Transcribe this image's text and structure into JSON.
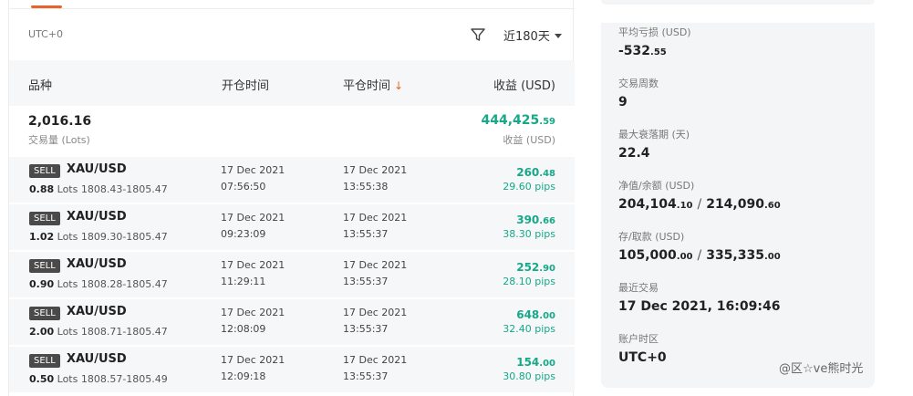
{
  "filter": {
    "timezone": "UTC+0",
    "period": "近180天"
  },
  "table": {
    "headers": {
      "symbol": "品种",
      "open_time": "开仓时间",
      "close_time": "平仓时间",
      "profit": "收益 (USD)"
    }
  },
  "summary": {
    "volume": "2,016.16",
    "volume_label": "交易量 (Lots)",
    "profit_int": "444,425",
    "profit_dec": ".59",
    "profit_label": "收益 (USD)"
  },
  "trades": [
    {
      "side": "SELL",
      "symbol": "XAU/USD",
      "lots": "0.88",
      "lots_suffix": " Lots  1808.43-1805.47",
      "open_date": "17 Dec 2021",
      "open_time": "07:56:50",
      "close_date": "17 Dec 2021",
      "close_time": "13:55:38",
      "profit_int": "260",
      "profit_dec": ".48",
      "pips": "29.60 pips"
    },
    {
      "side": "SELL",
      "symbol": "XAU/USD",
      "lots": "1.02",
      "lots_suffix": " Lots  1809.30-1805.47",
      "open_date": "17 Dec 2021",
      "open_time": "09:23:09",
      "close_date": "17 Dec 2021",
      "close_time": "13:55:37",
      "profit_int": "390",
      "profit_dec": ".66",
      "pips": "38.30 pips"
    },
    {
      "side": "SELL",
      "symbol": "XAU/USD",
      "lots": "0.90",
      "lots_suffix": " Lots  1808.28-1805.47",
      "open_date": "17 Dec 2021",
      "open_time": "11:29:11",
      "close_date": "17 Dec 2021",
      "close_time": "13:55:37",
      "profit_int": "252",
      "profit_dec": ".90",
      "pips": "28.10 pips"
    },
    {
      "side": "SELL",
      "symbol": "XAU/USD",
      "lots": "2.00",
      "lots_suffix": " Lots  1808.71-1805.47",
      "open_date": "17 Dec 2021",
      "open_time": "12:08:09",
      "close_date": "17 Dec 2021",
      "close_time": "13:55:37",
      "profit_int": "648",
      "profit_dec": ".00",
      "pips": "32.40 pips"
    },
    {
      "side": "SELL",
      "symbol": "XAU/USD",
      "lots": "0.50",
      "lots_suffix": " Lots  1808.57-1805.49",
      "open_date": "17 Dec 2021",
      "open_time": "12:09:18",
      "close_date": "17 Dec 2021",
      "close_time": "13:55:37",
      "profit_int": "154",
      "profit_dec": ".00",
      "pips": "30.80 pips"
    }
  ],
  "stats": {
    "avg_loss_label": "平均亏损 (USD)",
    "avg_loss_int": "-532",
    "avg_loss_dec": ".55",
    "weeks_label": "交易周数",
    "weeks": "9",
    "drawdown_label": "最大衰落期 (天)",
    "drawdown": "22.4",
    "equity_label": "净值/余额 (USD)",
    "equity_int": "204,104",
    "equity_dec": ".10",
    "balance_int": "214,090",
    "balance_dec": ".60",
    "deposit_label": "存/取款 (USD)",
    "deposit_int": "105,000",
    "deposit_dec": ".00",
    "withdraw_int": "335,335",
    "withdraw_dec": ".00",
    "last_trade_label": "最近交易",
    "last_trade": "17 Dec 2021, 16:09:46",
    "tz_label": "账户时区",
    "tz": "UTC+0",
    "slash": "/"
  },
  "watermark": "@区☆ve熊时光",
  "colors": {
    "profit": "#17a889",
    "accent": "#e8632c",
    "badge": "#4a4a4a",
    "panel": "#f4f5f6"
  },
  "icons": {
    "filter": "funnel-icon",
    "sort": "arrow-down-icon",
    "dropdown": "chevron-down-icon"
  }
}
